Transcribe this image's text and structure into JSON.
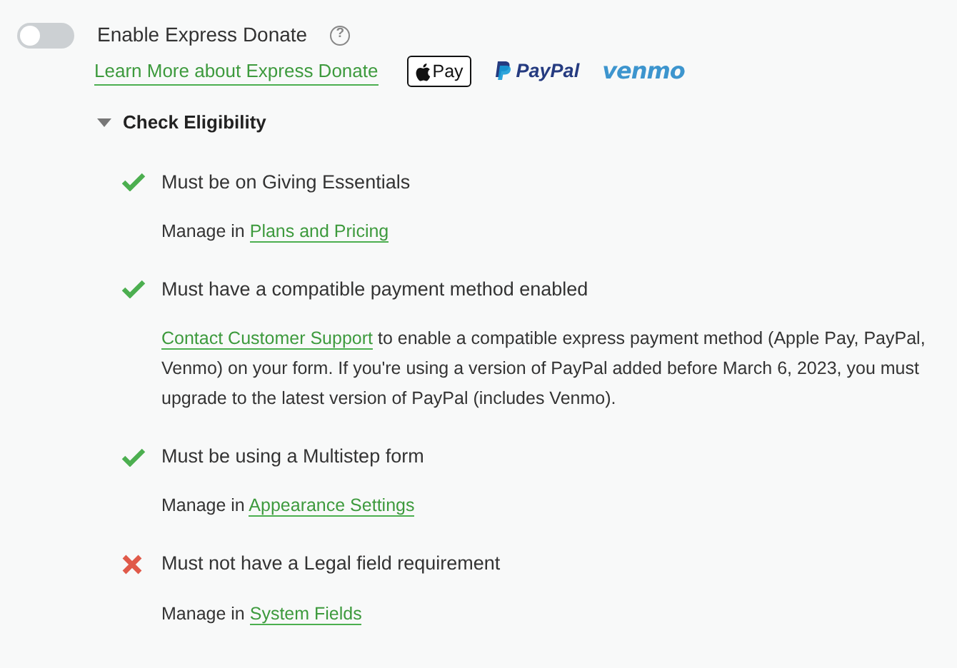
{
  "toggle": {
    "label": "Enable Express Donate",
    "on": false,
    "help_icon": "?"
  },
  "learn_more_link": "Learn More about Express Donate",
  "payment_logos": [
    {
      "kind": "applepay",
      "text": "Pay"
    },
    {
      "kind": "paypal",
      "text": "PayPal"
    },
    {
      "kind": "venmo",
      "text": "venmo"
    }
  ],
  "section": {
    "title": "Check Eligibility",
    "expanded": true
  },
  "criteria": [
    {
      "title": "Must be on Giving Essentials",
      "met": true,
      "prefix": "Manage in ",
      "link": "Plans and Pricing"
    },
    {
      "title": "Must have a compatible payment method enabled",
      "met": true,
      "link": "Contact Customer Support",
      "suffix": " to enable a compatible express payment method (Apple Pay, PayPal, Venmo) on your form. If you're using a version of PayPal added before March 6, 2023, you must upgrade to the latest version of PayPal (includes Venmo)."
    },
    {
      "title": "Must be using a Multistep form",
      "met": true,
      "prefix": "Manage in ",
      "link": "Appearance Settings"
    },
    {
      "title": "Must not have a Legal field requirement",
      "met": false,
      "prefix": "Manage in ",
      "link": "System Fields"
    }
  ]
}
